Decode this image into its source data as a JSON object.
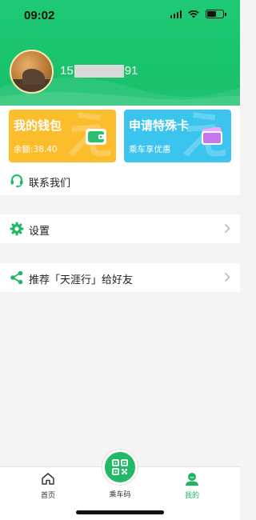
{
  "status_bar": {
    "time": "09:02"
  },
  "profile": {
    "phone_prefix": "15",
    "phone_suffix": "91"
  },
  "cards": {
    "wallet": {
      "title": "我的钱包",
      "subtitle": "余额:38.40"
    },
    "special_card": {
      "title": "申请特殊卡",
      "subtitle": "乘车享优惠"
    }
  },
  "menu": {
    "contact": "联系我们",
    "settings": "设置",
    "recommend": "推荐「天涯行」给好友"
  },
  "bottom_nav": {
    "home": "首页",
    "qr": "乘车码",
    "mine": "我的"
  },
  "colors": {
    "brand_green": "#1fca76",
    "wallet_yellow": "#fbbd2c",
    "card_blue": "#3bc4ee"
  }
}
